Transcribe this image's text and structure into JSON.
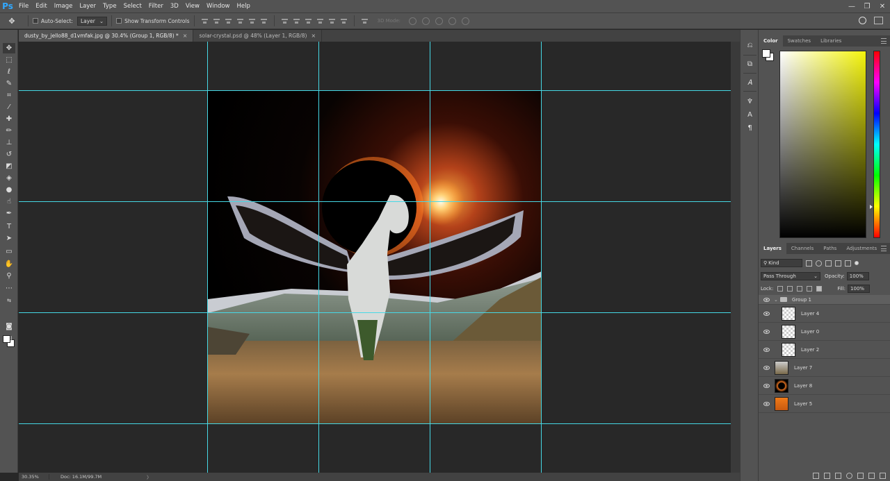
{
  "app": {
    "logo": "Ps"
  },
  "menu": [
    "File",
    "Edit",
    "Image",
    "Layer",
    "Type",
    "Select",
    "Filter",
    "3D",
    "View",
    "Window",
    "Help"
  ],
  "window_controls": {
    "minimize": "—",
    "restore": "❐",
    "close": "✕"
  },
  "options_bar": {
    "auto_select_label": "Auto-Select:",
    "auto_select_target": "Layer",
    "show_transform_label": "Show Transform Controls",
    "mode_3d_label": "3D Mode:"
  },
  "tabs": [
    {
      "label": "dusty_by_jello88_d1vmfak.jpg @ 30.4% (Group 1, RGB/8) *",
      "close": "×"
    },
    {
      "label": "solar-crystal.psd @ 48% (Layer 1, RGB/8)",
      "close": "×"
    }
  ],
  "status": {
    "zoom": "30.35%",
    "doc": "Doc: 16.1M/99.7M",
    "arrow": "〉"
  },
  "color_panel": {
    "tabs": [
      "Color",
      "Swatches",
      "Libraries"
    ]
  },
  "layers_panel": {
    "tabs": [
      "Layers",
      "Channels",
      "Paths",
      "Adjustments"
    ],
    "filter_label": "Kind",
    "blend_mode": "Pass Through",
    "opacity_label": "Opacity:",
    "opacity_value": "100%",
    "lock_label": "Lock:",
    "fill_label": "Fill:",
    "fill_value": "100%",
    "group": {
      "name": "Group 1"
    },
    "layers": [
      {
        "name": "Layer 4",
        "in_group": true
      },
      {
        "name": "Layer 0",
        "in_group": true
      },
      {
        "name": "Layer 2",
        "in_group": true
      },
      {
        "name": "Layer 7",
        "in_group": false
      },
      {
        "name": "Layer 8",
        "in_group": false
      },
      {
        "name": "Layer 5",
        "in_group": false
      }
    ]
  },
  "colors": {
    "guide": "#46d9e6",
    "ps_blue": "#31a8ff",
    "foreground": "#ffffff",
    "background": "#ffffff"
  }
}
